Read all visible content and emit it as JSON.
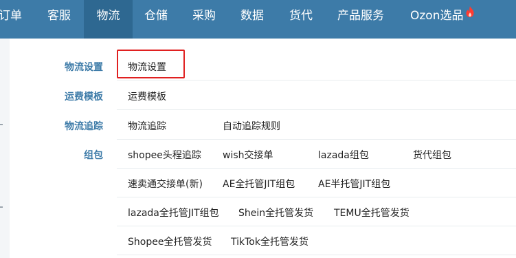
{
  "nav": {
    "items": [
      {
        "label": "订单"
      },
      {
        "label": "客服"
      },
      {
        "label": "物流"
      },
      {
        "label": "仓储"
      },
      {
        "label": "采购"
      },
      {
        "label": "数据"
      },
      {
        "label": "货代"
      },
      {
        "label": "产品服务"
      },
      {
        "label": "Ozon选品"
      }
    ],
    "active_index": 2,
    "bg_color": "#3d7ba8",
    "active_bg_color": "#2e6891",
    "hot_icon": "fire-icon"
  },
  "dropdown": {
    "categories": [
      {
        "label": "物流设置",
        "links": [
          {
            "label": "物流设置"
          }
        ]
      },
      {
        "label": "运费模板",
        "links": [
          {
            "label": "运费模板"
          }
        ]
      },
      {
        "label": "物流追踪",
        "links": [
          {
            "label": "物流追踪"
          },
          {
            "label": "自动追踪规则"
          }
        ]
      },
      {
        "label": "组包",
        "links": [
          {
            "label": "shopee头程追踪"
          },
          {
            "label": "wish交接单"
          },
          {
            "label": "lazada组包"
          },
          {
            "label": "货代组包"
          },
          {
            "label": "速卖通交接单(新)"
          },
          {
            "label": "AE全托管JIT组包"
          },
          {
            "label": "AE半托管JIT组包"
          },
          {
            "label": "lazada全托管JIT组包"
          },
          {
            "label": "Shein全托管发货"
          },
          {
            "label": "TEMU全托管发货"
          },
          {
            "label": "Shopee全托管发货"
          },
          {
            "label": "TikTok全托管发货"
          }
        ]
      }
    ],
    "category_color": "#3d7ba8",
    "highlight_color": "#e02020"
  }
}
